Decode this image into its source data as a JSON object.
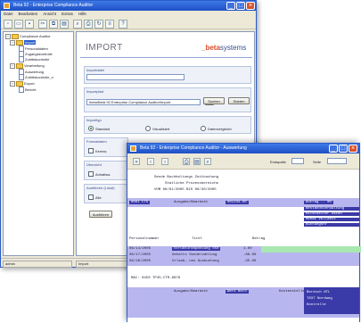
{
  "win1": {
    "title": "Beta 92 - Enterprise Compliance Auditor",
    "menu": [
      "Datei",
      "Bearbeiten",
      "Ansicht",
      "Extras",
      "Hilfe"
    ],
    "tree": [
      {
        "label": "Compliance Auditor",
        "level": 0,
        "type": "folder"
      },
      {
        "label": "Import",
        "level": 1,
        "type": "folder",
        "selected": true
      },
      {
        "label": "Personaldaten",
        "level": 2,
        "type": "doc"
      },
      {
        "label": "Zugangskontrolle",
        "level": 2,
        "type": "doc"
      },
      {
        "label": "Zutrittskontrolle",
        "level": 2,
        "type": "doc"
      },
      {
        "label": "Verarbeitung",
        "level": 1,
        "type": "folder"
      },
      {
        "label": "Auswertung",
        "level": 2,
        "type": "doc"
      },
      {
        "label": "Zutrittskontrolle_n",
        "level": 2,
        "type": "doc"
      },
      {
        "label": "Export",
        "level": 1,
        "type": "folder"
      },
      {
        "label": "Bericht",
        "level": 2,
        "type": "doc"
      }
    ],
    "page_title": "IMPORT",
    "brand_prefix": "_beta",
    "brand_suffix": "systems",
    "group1_label": "Importdatei",
    "group2_label": "Importpfad",
    "path_value": "\\beta\\Beta 92 Enterprise Compliance Auditor\\Import",
    "browse_label": "...",
    "btn_search": "Suchen",
    "btn_start": "Starten",
    "group3_label": "Importtyp",
    "radio_1": "Standard",
    "radio_2": "Visualisiert",
    "radio_3": "Datenvergleich",
    "group4_label": "Formatdaten",
    "check_1": "Kennw.",
    "group5_label": "Übersicht",
    "check_2": "Anhaltsw.",
    "group6_label": "Ausführen (Lokal)",
    "check_3": "Alle",
    "btn_bottom": "Ausführen",
    "status_left": "admin",
    "status_mid": "Import"
  },
  "win2": {
    "title": "Beta 92 - Enterprise Compliance Auditor - Auswertung",
    "zoom_label": "Endspalte",
    "page_label": "Seite",
    "header_line1": "Sende Buchhaltungs Zeitbuchung",
    "header_line2": "Statliche Prozessbereiche",
    "header_line3": "VOM 06/01/2005 BIS 06/30/2005",
    "row1_a": "0001    CTS",
    "row1_b": "Ausgabe/Bearbeit",
    "row1_c": "001234.00",
    "row1_d": "Kontrolle",
    "row1_e": "Antrag .. 00",
    "side_lines": [
      "Bestandsverwaltung",
      "Mitarbeiter Daten",
      "Monat Vollzeit",
      "Buchungsnr"
    ],
    "col_headers": [
      "Personalnummer",
      "Titel",
      "Betrag"
    ],
    "rows": [
      {
        "a": "06/14/2005",
        "b": "Strukturanpassung  050",
        "c": "1.00",
        "d": ""
      },
      {
        "a": "06/17/2005",
        "b": "Gehalts Sonderzahlung",
        "c": "-88.00",
        "d": ""
      },
      {
        "a": "06/28/2005",
        "b": "Urlaub, neu Ausbuchung",
        "c": "-35.00",
        "d": ""
      }
    ],
    "footer_a": "MAI:  0450  TP45-CTR-8876",
    "footer_b": "Ausgabe/Bearbeit",
    "footer_c": "Werk Nord",
    "footer_d": "Kostenstelle",
    "footer_side": [
      "Bereich  NTL",
      "7837  Nordweg",
      "Kontrolle"
    ]
  }
}
